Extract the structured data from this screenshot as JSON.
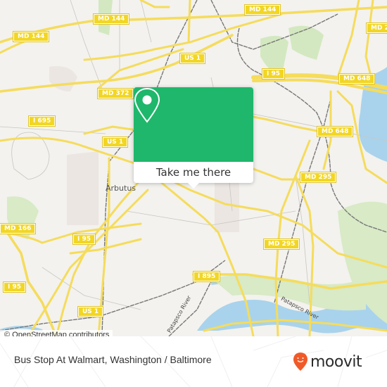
{
  "map": {
    "road_shields": [
      {
        "label": "MD 144"
      },
      {
        "label": "MD 144"
      },
      {
        "label": "MD 144"
      },
      {
        "label": "MD 2"
      },
      {
        "label": "US 1"
      },
      {
        "label": "I 95"
      },
      {
        "label": "MD 648"
      },
      {
        "label": "MD 372"
      },
      {
        "label": "I 695"
      },
      {
        "label": "US 1"
      },
      {
        "label": "MD 648"
      },
      {
        "label": "MD 295"
      },
      {
        "label": "MD 166"
      },
      {
        "label": "I 95"
      },
      {
        "label": "MD 295"
      },
      {
        "label": "I 895"
      },
      {
        "label": "I 95"
      },
      {
        "label": "US 1"
      }
    ],
    "place_label": "Arbutus",
    "river_labels": [
      "Patapsco River",
      "Patapsco River"
    ],
    "attribution": "© OpenStreetMap contributors"
  },
  "popup": {
    "icon": "map-pin-icon",
    "button_label": "Take me there",
    "accent_color": "#1fb76b"
  },
  "footer": {
    "title": "Bus Stop At Walmart, Washington / Baltimore",
    "logo_text": "moovit",
    "logo_color": "#f05a28"
  }
}
